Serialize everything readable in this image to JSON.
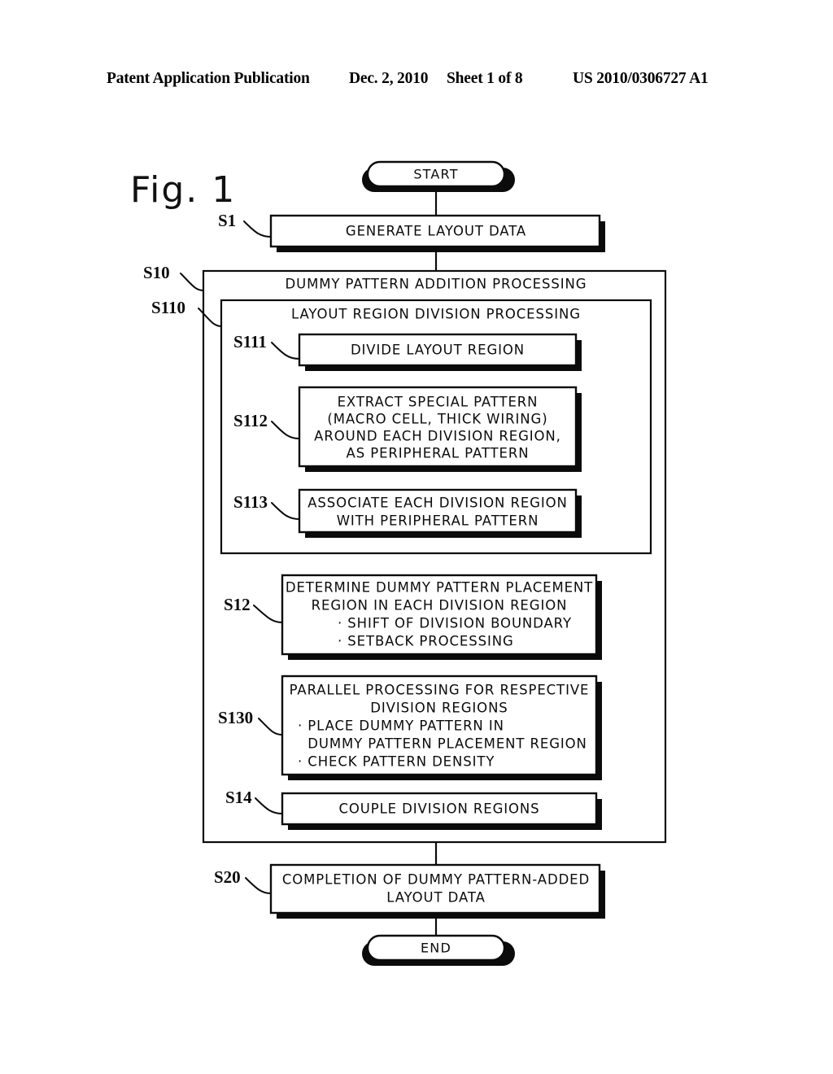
{
  "header": {
    "publication": "Patent Application Publication",
    "date": "Dec. 2, 2010",
    "sheet": "Sheet 1 of 8",
    "patent_number": "US 2010/0306727 A1"
  },
  "figure": {
    "caption": "Fig. 1",
    "type": "flowchart"
  },
  "flowchart": {
    "start": {
      "label": "START",
      "shape": "terminator"
    },
    "end": {
      "label": "END",
      "shape": "terminator"
    },
    "nodes": [
      {
        "id": "S1",
        "step": "S1",
        "shape": "process",
        "lines": [
          "GENERATE LAYOUT DATA"
        ],
        "align": "center"
      },
      {
        "id": "S10",
        "step": "S10",
        "shape": "container",
        "lines": [
          "DUMMY PATTERN ADDITION PROCESSING"
        ],
        "align": "center"
      },
      {
        "id": "S110",
        "step": "S110",
        "shape": "container",
        "lines": [
          "LAYOUT REGION DIVISION PROCESSING"
        ],
        "align": "center"
      },
      {
        "id": "S111",
        "step": "S111",
        "shape": "process",
        "lines": [
          "DIVIDE LAYOUT REGION"
        ],
        "align": "center"
      },
      {
        "id": "S112",
        "step": "S112",
        "shape": "process",
        "lines": [
          "EXTRACT SPECIAL PATTERN",
          "(MACRO CELL, THICK WIRING)",
          "AROUND EACH DIVISION REGION,",
          "AS PERIPHERAL PATTERN"
        ],
        "align": "center"
      },
      {
        "id": "S113",
        "step": "S113",
        "shape": "process",
        "lines": [
          "ASSOCIATE EACH DIVISION REGION",
          "WITH PERIPHERAL PATTERN"
        ],
        "align": "center"
      },
      {
        "id": "S12",
        "step": "S12",
        "shape": "process",
        "lines": [
          "DETERMINE DUMMY PATTERN PLACEMENT",
          "REGION IN EACH DIVISION REGION",
          "· SHIFT OF DIVISION BOUNDARY",
          "· SETBACK PROCESSING"
        ],
        "align": "mixed"
      },
      {
        "id": "S130",
        "step": "S130",
        "shape": "process",
        "lines": [
          "PARALLEL PROCESSING FOR RESPECTIVE",
          "DIVISION REGIONS",
          "· PLACE DUMMY PATTERN IN",
          "  DUMMY PATTERN PLACEMENT REGION",
          "· CHECK PATTERN DENSITY"
        ],
        "align": "mixed"
      },
      {
        "id": "S14",
        "step": "S14",
        "shape": "process",
        "lines": [
          "COUPLE DIVISION REGIONS"
        ],
        "align": "center"
      },
      {
        "id": "S20",
        "step": "S20",
        "shape": "process",
        "lines": [
          "COMPLETION OF DUMMY PATTERN-ADDED",
          "LAYOUT DATA"
        ],
        "align": "center"
      }
    ]
  }
}
